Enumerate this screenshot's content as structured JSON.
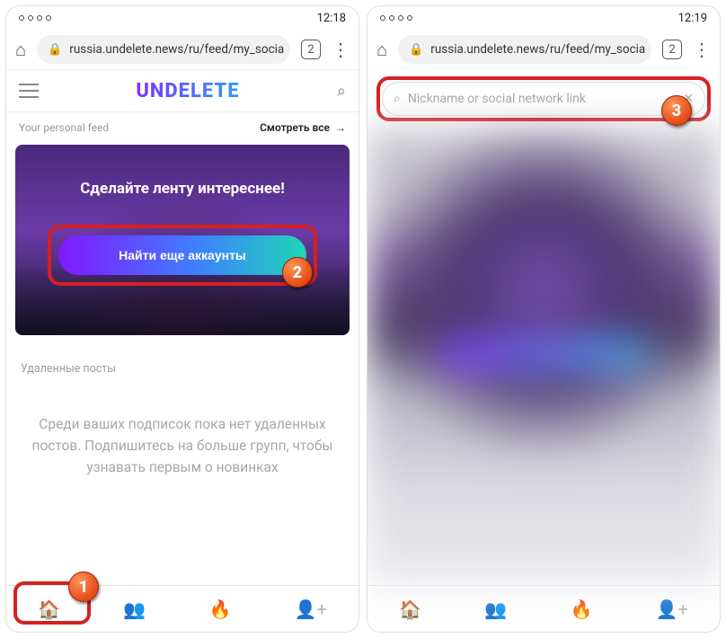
{
  "left": {
    "status_time": "12:18",
    "url": "russia.undelete.news/ru/feed/my_socia",
    "tabcount": "2",
    "logo": "UNDELETE",
    "feed_label": "Your personal feed",
    "see_all": "Смотреть все",
    "hero_title": "Сделайте ленту интереснее!",
    "hero_button": "Найти еще аккаунты",
    "deleted_title": "Удаленные посты",
    "empty_text": "Среди ваших подписок пока нет удаленных постов. Подпишитесь на больше групп, чтобы узнавать первым о новинках"
  },
  "right": {
    "status_time": "12:19",
    "url": "russia.undelete.news/ru/feed/my_socia",
    "tabcount": "2",
    "search_placeholder": "Nickname or social network link"
  },
  "badges": {
    "b1": "1",
    "b2": "2",
    "b3": "3"
  }
}
